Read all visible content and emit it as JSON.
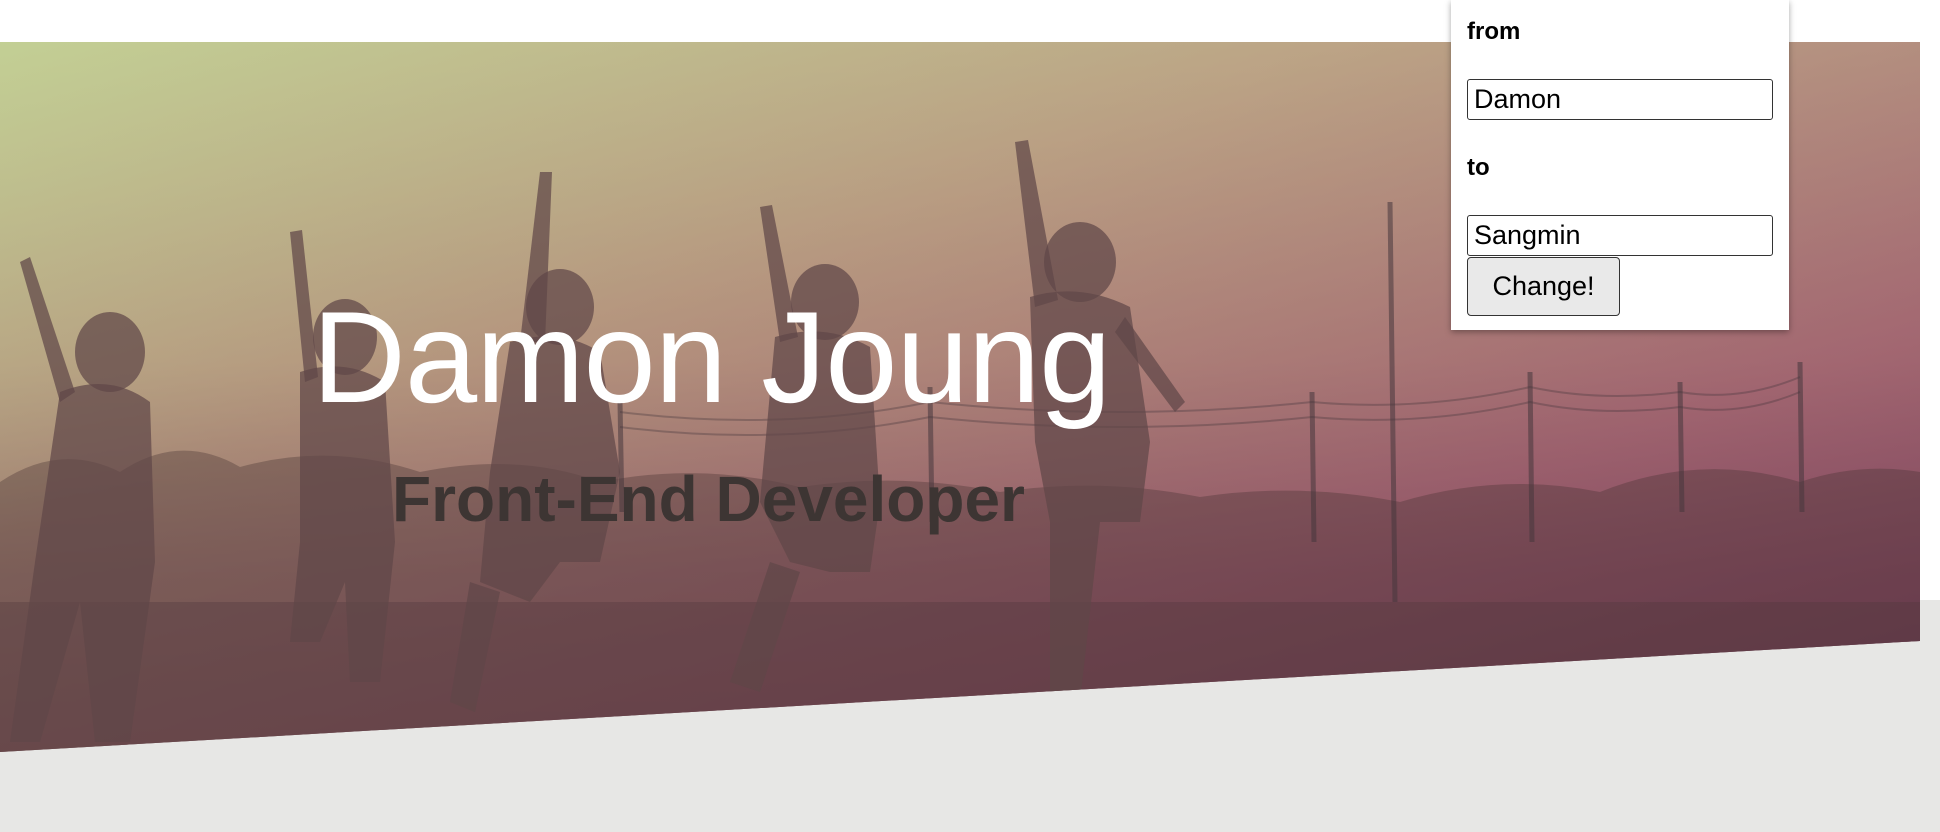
{
  "hero": {
    "title": "Damon Joung",
    "subtitle": "Front-End Developer",
    "background_image": "group-of-people-jumping-at-sunset-photo",
    "gradient_colors": [
      "#c4d696",
      "#a8707e",
      "#784062"
    ]
  },
  "swap_form": {
    "from_label": "from",
    "from_value": "Damon",
    "to_label": "to",
    "to_value": "Sangmin",
    "button_label": "Change!"
  },
  "colors": {
    "lower_area": "#e7e7e5",
    "title_text": "#ffffff",
    "subtitle_text": "#3d3533"
  }
}
